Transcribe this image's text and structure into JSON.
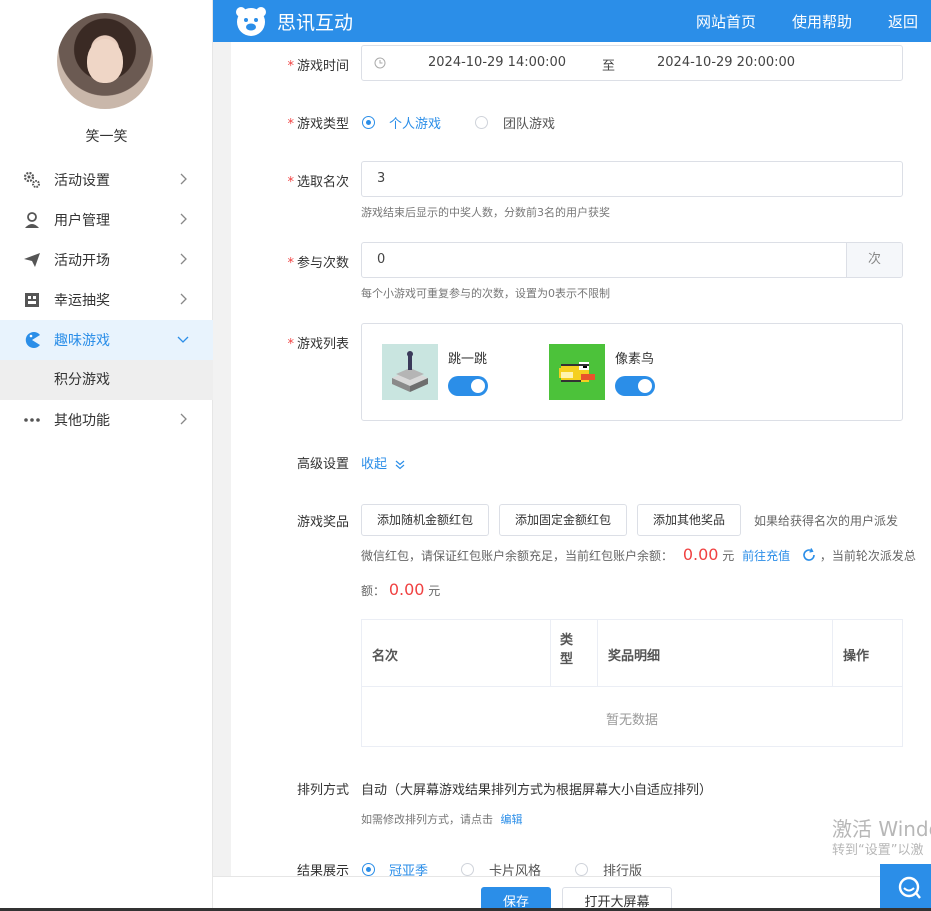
{
  "sidebar": {
    "username": "笑一笑",
    "menu": [
      {
        "label": "活动设置",
        "icon": "gears-icon"
      },
      {
        "label": "用户管理",
        "icon": "user-icon"
      },
      {
        "label": "活动开场",
        "icon": "paper-plane-icon"
      },
      {
        "label": "幸运抽奖",
        "icon": "lottery-icon"
      },
      {
        "label": "趣味游戏",
        "icon": "game-icon",
        "active": true
      },
      {
        "label": "其他功能",
        "icon": "more-dots-icon"
      }
    ],
    "submenu": [
      "积分游戏"
    ]
  },
  "topbar": {
    "brand": "思讯互动",
    "nav": [
      "网站首页",
      "使用帮助",
      "返回"
    ]
  },
  "form": {
    "game_time": {
      "label": "游戏时间",
      "start": "2024-10-29 14:00:00",
      "separator": "至",
      "end": "2024-10-29 20:00:00"
    },
    "game_type": {
      "label": "游戏类型",
      "options": [
        "个人游戏",
        "团队游戏"
      ],
      "selected": "个人游戏"
    },
    "pick_rank": {
      "label": "选取名次",
      "value": "3",
      "hint": "游戏结束后显示的中奖人数，分数前3名的用户获奖"
    },
    "join_times": {
      "label": "参与次数",
      "value": "0",
      "suffix": "次",
      "hint": "每个小游戏可重复参与的次数，设置为0表示不限制"
    },
    "game_list": {
      "label": "游戏列表",
      "games": [
        {
          "name": "跳一跳",
          "enabled": true
        },
        {
          "name": "像素鸟",
          "enabled": true
        }
      ]
    },
    "advanced": {
      "label": "高级设置",
      "toggle": "收起"
    },
    "prizes": {
      "label": "游戏奖品",
      "buttons": [
        "添加随机金额红包",
        "添加固定金额红包",
        "添加其他奖品"
      ],
      "after_buttons": "如果给获得名次的用户派发",
      "balance_text": "微信红包，请保证红包账户余额充足，当前红包账户余额：",
      "balance_value": "0.00",
      "yuan": "元",
      "recharge": "前往充值",
      "total_text_1": "，当前轮次派发总",
      "total_text_2": "额：",
      "total_value": "0.00",
      "table": {
        "headers": [
          "名次",
          "类型",
          "奖品明细",
          "操作"
        ],
        "empty": "暂无数据"
      }
    },
    "arrange": {
      "label": "排列方式",
      "value": "自动（大屏幕游戏结果排列方式为根据屏幕大小自适应排列）",
      "hint": "如需修改排列方式，请点击",
      "edit": "编辑"
    },
    "result_display": {
      "label": "结果展示",
      "options": [
        "冠亚季",
        "卡片风格",
        "排行版"
      ],
      "selected": "冠亚季"
    }
  },
  "footer": {
    "save": "保存",
    "open_screen": "打开大屏幕"
  },
  "watermark": {
    "line1": "激活 Windo",
    "line2": "转到“设置”以激"
  },
  "colors": {
    "primary": "#2b8ee8",
    "required": "#f04141"
  }
}
